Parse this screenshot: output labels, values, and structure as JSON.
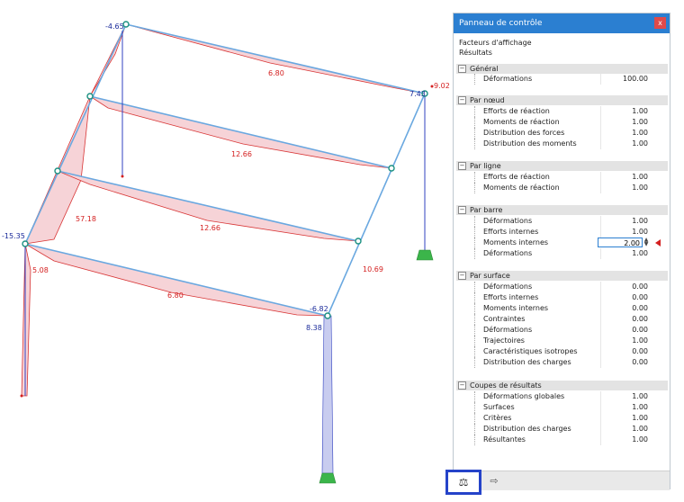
{
  "panel": {
    "title": "Panneau de contrôle",
    "close_label": "x",
    "head_line1": "Facteurs d'affichage",
    "head_line2": "Résultats"
  },
  "groups": [
    {
      "label": "Général",
      "collapse": "−"
    },
    {
      "label": "Par nœud",
      "collapse": "−"
    },
    {
      "label": "Par ligne",
      "collapse": "−"
    },
    {
      "label": "Par barre",
      "collapse": "−"
    },
    {
      "label": "Par surface",
      "collapse": "−"
    },
    {
      "label": "Coupes de résultats",
      "collapse": "−"
    }
  ],
  "rows": {
    "general": [
      {
        "label": "Déformations",
        "value": "100.00"
      }
    ],
    "noeud": [
      {
        "label": "Efforts de réaction",
        "value": "1.00"
      },
      {
        "label": "Moments de réaction",
        "value": "1.00"
      },
      {
        "label": "Distribution des forces",
        "value": "1.00"
      },
      {
        "label": "Distribution des moments",
        "value": "1.00"
      }
    ],
    "ligne": [
      {
        "label": "Efforts de réaction",
        "value": "1.00"
      },
      {
        "label": "Moments de réaction",
        "value": "1.00"
      }
    ],
    "barre": [
      {
        "label": "Déformations",
        "value": "1.00"
      },
      {
        "label": "Efforts internes",
        "value": "1.00"
      },
      {
        "label": "Moments internes",
        "value": "2.00"
      },
      {
        "label": "Déformations",
        "value": "1.00"
      }
    ],
    "surface": [
      {
        "label": "Déformations",
        "value": "0.00"
      },
      {
        "label": "Efforts internes",
        "value": "0.00"
      },
      {
        "label": "Moments internes",
        "value": "0.00"
      },
      {
        "label": "Contraintes",
        "value": "0.00"
      },
      {
        "label": "Déformations",
        "value": "0.00"
      },
      {
        "label": "Trajectoires",
        "value": "1.00"
      },
      {
        "label": "Caractéristiques isotropes",
        "value": "0.00"
      },
      {
        "label": "Distribution des charges",
        "value": "0.00"
      }
    ],
    "coupes": [
      {
        "label": "Déformations globales",
        "value": "1.00"
      },
      {
        "label": "Surfaces",
        "value": "1.00"
      },
      {
        "label": "Critères",
        "value": "1.00"
      },
      {
        "label": "Distribution des charges",
        "value": "1.00"
      },
      {
        "label": "Résultantes",
        "value": "1.00"
      }
    ]
  },
  "spinner": {
    "up": "▲",
    "down": "▼"
  },
  "footer": {
    "scale_icon": "balance-icon ⚖",
    "scale_glyph": "⚖",
    "export_glyph": "⇨"
  },
  "model_labels": {
    "v1": "-4.65",
    "v2": "7.43",
    "v3": "9.02",
    "v4": "6.80",
    "v5": "12.66",
    "v6": "57.18",
    "v7": "12.66",
    "v8": "-15.35",
    "v9": "5.08",
    "v10": "6.80",
    "v11": "10.69",
    "v12": "-6.82",
    "v13": "8.38"
  },
  "colors": {
    "beam": "#6aa8e0",
    "moment_fill": "#f6cfd3",
    "moment_line": "#d42020",
    "column": "#3040c0",
    "support": "#3bb54a",
    "highlight": "#2543c9"
  }
}
